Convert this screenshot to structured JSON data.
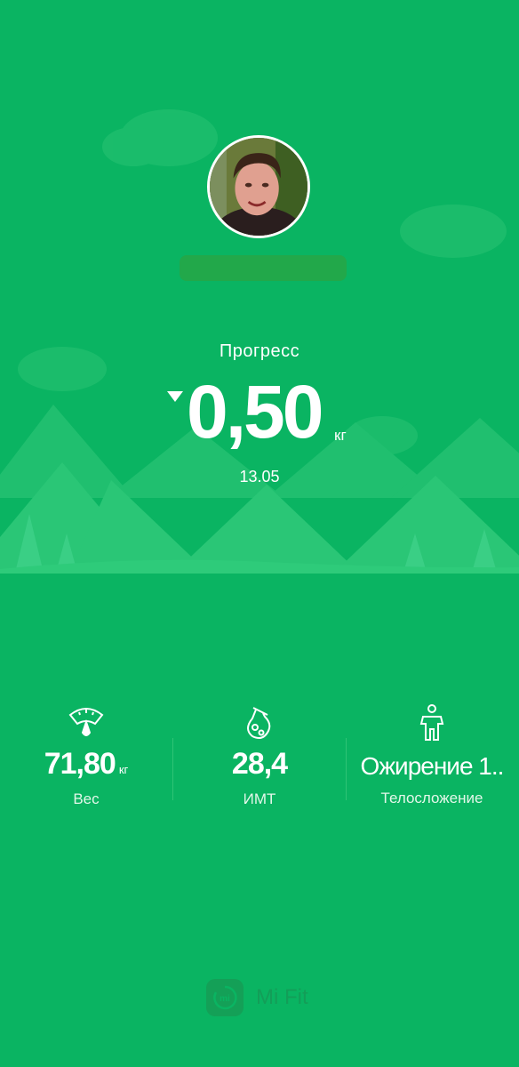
{
  "progress": {
    "label": "Прогресс",
    "value": "0,50",
    "unit": "кг",
    "direction": "down",
    "date": "13.05"
  },
  "stats": [
    {
      "icon": "scale-icon",
      "value": "71,80",
      "unit": "кг",
      "label": "Вес"
    },
    {
      "icon": "bmi-flask-icon",
      "value": "28,4",
      "label": "ИМТ"
    },
    {
      "icon": "body-figure-icon",
      "value": "Ожирение 1..",
      "label": "Телосложение"
    }
  ],
  "brand": {
    "logo_text": "mi",
    "name": "Mi Fit"
  },
  "colors": {
    "background": "#0ab462",
    "hills": "#2ec97a",
    "text": "#ffffff"
  }
}
